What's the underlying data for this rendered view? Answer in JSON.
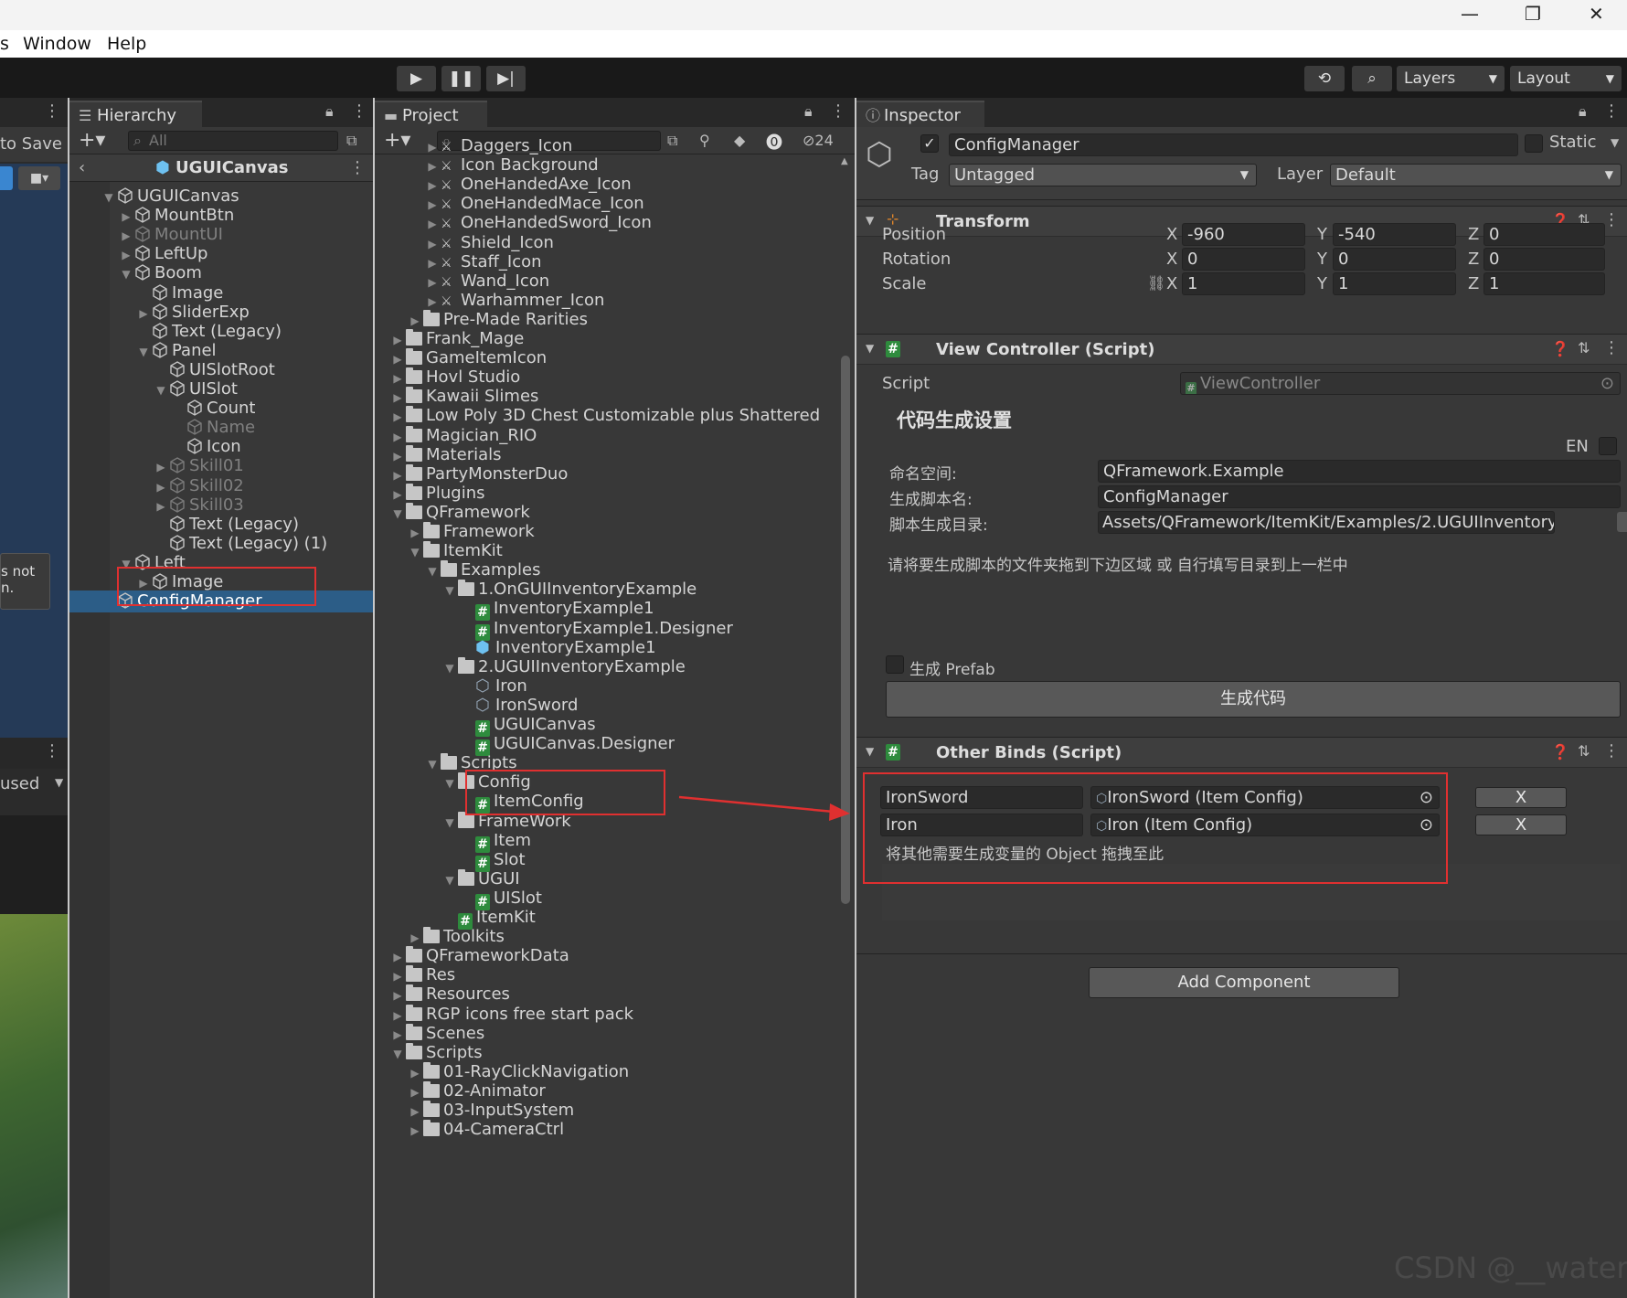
{
  "window": {
    "minimize": "—",
    "restore": "❐",
    "close": "✕"
  },
  "menu": {
    "partial": "s",
    "window": "Window",
    "help": "Help"
  },
  "toolbar": {
    "layers": "Layers",
    "layout": "Layout"
  },
  "scene": {
    "partial_label": "to Save",
    "partial_text": "s not\nn.",
    "used": "used"
  },
  "hierarchy": {
    "tab": "Hierarchy",
    "search": "All",
    "root": "UGUICanvas",
    "items": [
      {
        "label": "UGUICanvas",
        "indent": 0,
        "arrow": "▼",
        "dim": false
      },
      {
        "label": "MountBtn",
        "indent": 1,
        "arrow": "▶",
        "dim": false
      },
      {
        "label": "MountUI",
        "indent": 1,
        "arrow": "▶",
        "dim": true
      },
      {
        "label": "LeftUp",
        "indent": 1,
        "arrow": "▶",
        "dim": false
      },
      {
        "label": "Boom",
        "indent": 1,
        "arrow": "▼",
        "dim": false
      },
      {
        "label": "Image",
        "indent": 2,
        "arrow": "",
        "dim": false
      },
      {
        "label": "SliderExp",
        "indent": 2,
        "arrow": "▶",
        "dim": false
      },
      {
        "label": "Text (Legacy)",
        "indent": 2,
        "arrow": "",
        "dim": false
      },
      {
        "label": "Panel",
        "indent": 2,
        "arrow": "▼",
        "dim": false
      },
      {
        "label": "UISlotRoot",
        "indent": 3,
        "arrow": "",
        "dim": false
      },
      {
        "label": "UISlot",
        "indent": 3,
        "arrow": "▼",
        "dim": false
      },
      {
        "label": "Count",
        "indent": 4,
        "arrow": "",
        "dim": false
      },
      {
        "label": "Name",
        "indent": 4,
        "arrow": "",
        "dim": true
      },
      {
        "label": "Icon",
        "indent": 4,
        "arrow": "",
        "dim": false
      },
      {
        "label": "Skill01",
        "indent": 3,
        "arrow": "▶",
        "dim": true
      },
      {
        "label": "Skill02",
        "indent": 3,
        "arrow": "▶",
        "dim": true
      },
      {
        "label": "Skill03",
        "indent": 3,
        "arrow": "▶",
        "dim": true
      },
      {
        "label": "Text (Legacy)",
        "indent": 3,
        "arrow": "",
        "dim": false
      },
      {
        "label": "Text (Legacy) (1)",
        "indent": 3,
        "arrow": "",
        "dim": false
      },
      {
        "label": "Left",
        "indent": 1,
        "arrow": "▼",
        "dim": false
      },
      {
        "label": "Image",
        "indent": 2,
        "arrow": "▶",
        "dim": false
      },
      {
        "label": "ConfigManager",
        "indent": 0,
        "arrow": "",
        "dim": false,
        "selected": true
      }
    ]
  },
  "project": {
    "tab": "Project",
    "hidden_count": "24",
    "items": [
      {
        "label": "Daggers_Icon",
        "indent": 2,
        "type": "sprite"
      },
      {
        "label": "Icon Background",
        "indent": 2,
        "type": "sprite"
      },
      {
        "label": "OneHandedAxe_Icon",
        "indent": 2,
        "type": "sprite"
      },
      {
        "label": "OneHandedMace_Icon",
        "indent": 2,
        "type": "sprite"
      },
      {
        "label": "OneHandedSword_Icon",
        "indent": 2,
        "type": "sprite"
      },
      {
        "label": "Shield_Icon",
        "indent": 2,
        "type": "sprite"
      },
      {
        "label": "Staff_Icon",
        "indent": 2,
        "type": "sprite"
      },
      {
        "label": "Wand_Icon",
        "indent": 2,
        "type": "sprite"
      },
      {
        "label": "Warhammer_Icon",
        "indent": 2,
        "type": "sprite"
      },
      {
        "label": "Pre-Made Rarities",
        "indent": 1,
        "type": "folder",
        "arrow": "▶"
      },
      {
        "label": "Frank_Mage",
        "indent": 0,
        "type": "folder",
        "arrow": "▶"
      },
      {
        "label": "GameItemIcon",
        "indent": 0,
        "type": "folder",
        "arrow": "▶"
      },
      {
        "label": "Hovl Studio",
        "indent": 0,
        "type": "folder",
        "arrow": "▶"
      },
      {
        "label": "Kawaii Slimes",
        "indent": 0,
        "type": "folder",
        "arrow": "▶"
      },
      {
        "label": "Low Poly 3D Chest Customizable plus Shattered",
        "indent": 0,
        "type": "folder",
        "arrow": "▶"
      },
      {
        "label": "Magician_RIO",
        "indent": 0,
        "type": "folder",
        "arrow": "▶"
      },
      {
        "label": "Materials",
        "indent": 0,
        "type": "folder",
        "arrow": "▶"
      },
      {
        "label": "PartyMonsterDuo",
        "indent": 0,
        "type": "folder",
        "arrow": "▶"
      },
      {
        "label": "Plugins",
        "indent": 0,
        "type": "folder",
        "arrow": "▶"
      },
      {
        "label": "QFramework",
        "indent": 0,
        "type": "folder",
        "arrow": "▼"
      },
      {
        "label": "Framework",
        "indent": 1,
        "type": "folder",
        "arrow": "▶"
      },
      {
        "label": "ItemKit",
        "indent": 1,
        "type": "folder",
        "arrow": "▼"
      },
      {
        "label": "Examples",
        "indent": 2,
        "type": "folder",
        "arrow": "▼"
      },
      {
        "label": "1.OnGUIInventoryExample",
        "indent": 3,
        "type": "folder",
        "arrow": "▼"
      },
      {
        "label": "InventoryExample1",
        "indent": 4,
        "type": "script"
      },
      {
        "label": "InventoryExample1.Designer",
        "indent": 4,
        "type": "script"
      },
      {
        "label": "InventoryExample1",
        "indent": 4,
        "type": "prefab"
      },
      {
        "label": "2.UGUIInventoryExample",
        "indent": 3,
        "type": "folder",
        "arrow": "▼"
      },
      {
        "label": "Iron",
        "indent": 4,
        "type": "config"
      },
      {
        "label": "IronSword",
        "indent": 4,
        "type": "config"
      },
      {
        "label": "UGUICanvas",
        "indent": 4,
        "type": "script"
      },
      {
        "label": "UGUICanvas.Designer",
        "indent": 4,
        "type": "script"
      },
      {
        "label": "Scripts",
        "indent": 2,
        "type": "folder",
        "arrow": "▼"
      },
      {
        "label": "Config",
        "indent": 3,
        "type": "folder",
        "arrow": "▼"
      },
      {
        "label": "ItemConfig",
        "indent": 4,
        "type": "script"
      },
      {
        "label": "FrameWork",
        "indent": 3,
        "type": "folder",
        "arrow": "▼"
      },
      {
        "label": "Item",
        "indent": 4,
        "type": "script"
      },
      {
        "label": "Slot",
        "indent": 4,
        "type": "script"
      },
      {
        "label": "UGUI",
        "indent": 3,
        "type": "folder",
        "arrow": "▼"
      },
      {
        "label": "UISlot",
        "indent": 4,
        "type": "script"
      },
      {
        "label": "ItemKit",
        "indent": 3,
        "type": "script"
      },
      {
        "label": "Toolkits",
        "indent": 1,
        "type": "folder",
        "arrow": "▶"
      },
      {
        "label": "QFrameworkData",
        "indent": 0,
        "type": "folder",
        "arrow": "▶"
      },
      {
        "label": "Res",
        "indent": 0,
        "type": "folder",
        "arrow": "▶"
      },
      {
        "label": "Resources",
        "indent": 0,
        "type": "folder",
        "arrow": "▶"
      },
      {
        "label": "RGP icons free start pack",
        "indent": 0,
        "type": "folder",
        "arrow": "▶"
      },
      {
        "label": "Scenes",
        "indent": 0,
        "type": "folder",
        "arrow": "▶"
      },
      {
        "label": "Scripts",
        "indent": 0,
        "type": "folder",
        "arrow": "▼"
      },
      {
        "label": "01-RayClickNavigation",
        "indent": 1,
        "type": "folder",
        "arrow": "▶"
      },
      {
        "label": "02-Animator",
        "indent": 1,
        "type": "folder",
        "arrow": "▶"
      },
      {
        "label": "03-InputSystem",
        "indent": 1,
        "type": "folder",
        "arrow": "▶"
      },
      {
        "label": "04-CameraCtrl",
        "indent": 1,
        "type": "folder",
        "arrow": "▶"
      }
    ]
  },
  "inspector": {
    "tab": "Inspector",
    "object_name": "ConfigManager",
    "static": "Static",
    "tag_label": "Tag",
    "tag": "Untagged",
    "layer_label": "Layer",
    "layer": "Default",
    "transform": {
      "title": "Transform",
      "position": "Position",
      "rotation": "Rotation",
      "scale": "Scale",
      "x": "X",
      "y": "Y",
      "z": "Z",
      "pos": [
        "-960",
        "-540",
        "0"
      ],
      "rot": [
        "0",
        "0",
        "0"
      ],
      "scl": [
        "1",
        "1",
        "1"
      ]
    },
    "view_controller": {
      "title": "View Controller (Script)",
      "script_label": "Script",
      "script": "ViewController",
      "heading": "代码生成设置",
      "en": "EN",
      "ns_label": "命名空间:",
      "ns": "QFramework.Example",
      "name_label": "生成脚本名:",
      "name": "ConfigManager",
      "dir_label": "脚本生成目录:",
      "dir": "Assets/QFramework/ItemKit/Examples/2.UGUIInventoryExample",
      "hint": "请将要生成脚本的文件夹拖到下边区域 或 自行填写目录到上一栏中",
      "prefab": "生成 Prefab",
      "generate": "生成代码"
    },
    "other_binds": {
      "title": "Other Binds (Script)",
      "binds": [
        {
          "name": "IronSword",
          "ref": "IronSword (Item Config)",
          "x": "X"
        },
        {
          "name": "Iron",
          "ref": "Iron (Item Config)",
          "x": "X"
        }
      ],
      "hint": "将其他需要生成变量的 Object 拖拽至此"
    },
    "add_component": "Add Component"
  },
  "watermark": "CSDN @__water"
}
